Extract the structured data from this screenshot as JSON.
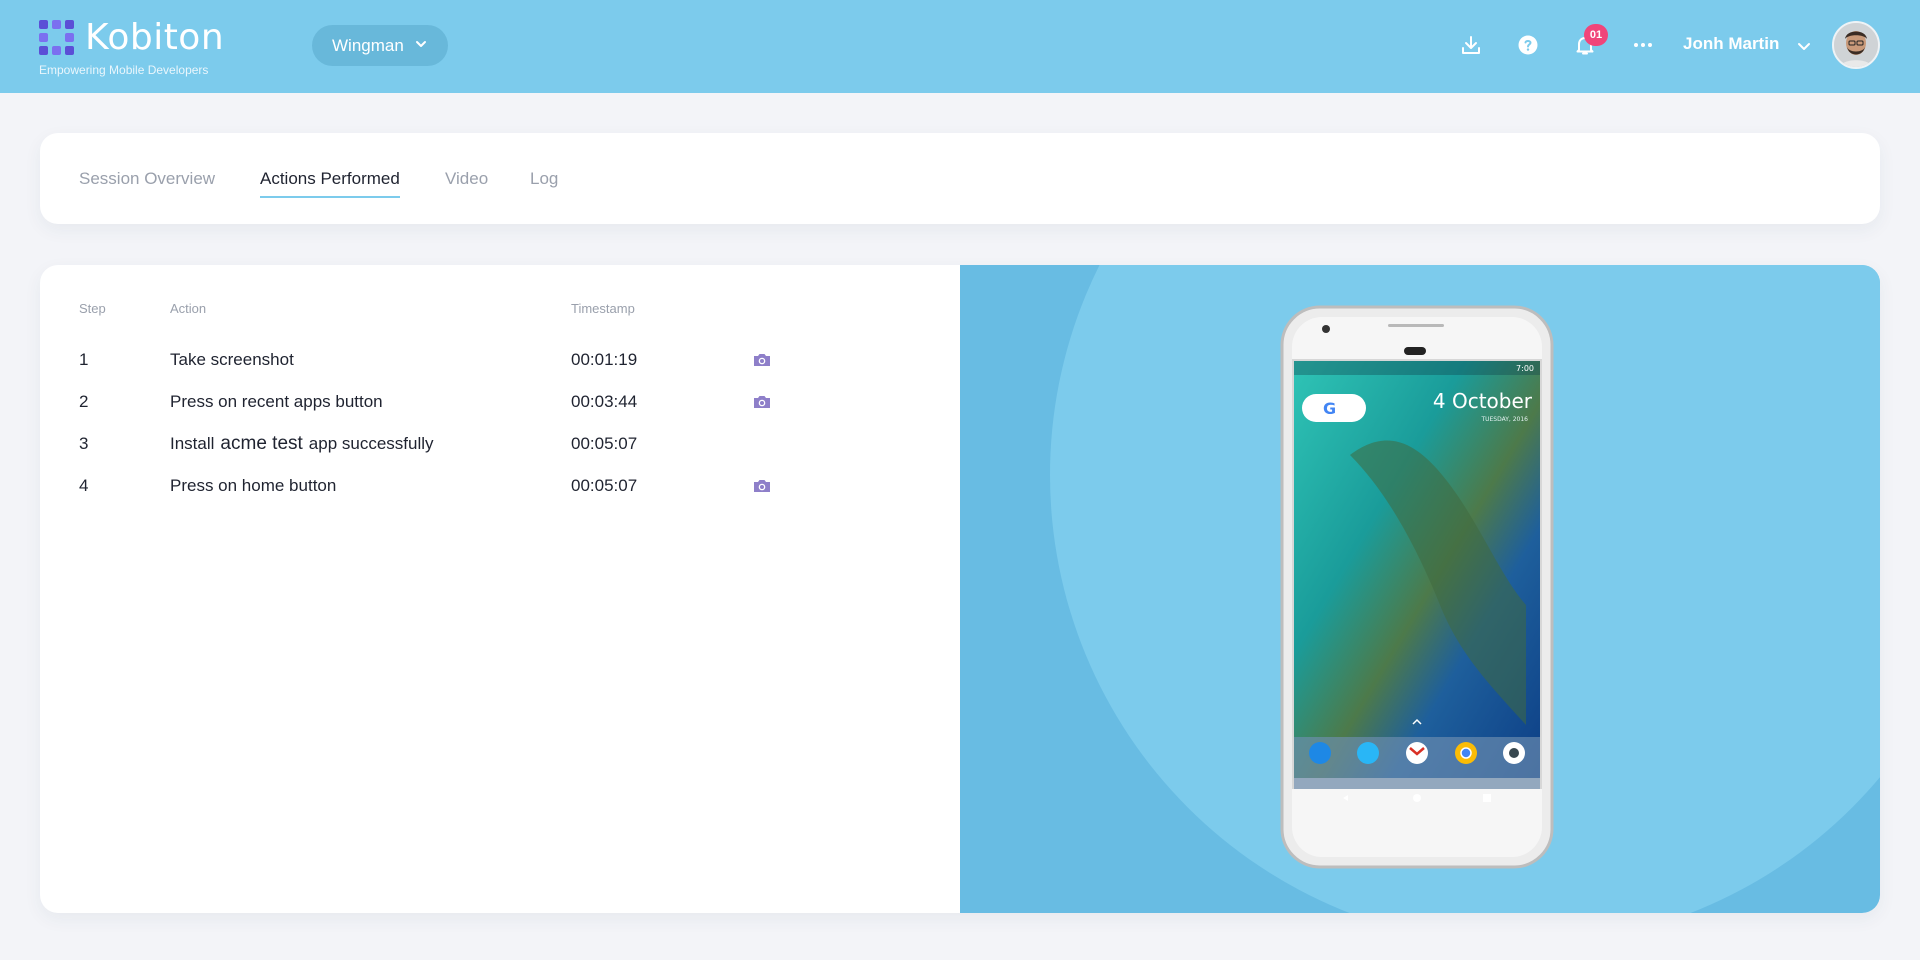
{
  "header": {
    "logo_name": "Kobiton",
    "logo_tagline": "Empowering Mobile Developers",
    "project_label": "Wingman",
    "notification_count": "01",
    "user_name": "Jonh Martin",
    "icons": [
      "download-icon",
      "help-icon",
      "bell-icon",
      "more-icon",
      "chevron-down-icon"
    ]
  },
  "tabs": [
    {
      "label": "Session Overview",
      "active": false
    },
    {
      "label": "Actions Performed",
      "active": true
    },
    {
      "label": "Video",
      "active": false
    },
    {
      "label": "Log",
      "active": false
    }
  ],
  "table": {
    "columns": {
      "step": "Step",
      "action": "Action",
      "timestamp": "Timestamp"
    },
    "rows": [
      {
        "step": "1",
        "action": "Take screenshot",
        "timestamp": "00:01:19",
        "has_screenshot": true
      },
      {
        "step": "2",
        "action": "Press on recent apps button",
        "timestamp": "00:03:44",
        "has_screenshot": true
      },
      {
        "step": "3",
        "action_prefix": "Install",
        "action_highlight": "acme test",
        "action_suffix": "app successfully",
        "timestamp": "00:05:07",
        "has_screenshot": false
      },
      {
        "step": "4",
        "action": "Press on home button",
        "timestamp": "00:05:07",
        "has_screenshot": true
      }
    ]
  },
  "device": {
    "date": "4 October",
    "weekday": "TUESDAY, 2016",
    "clock": "7:00"
  },
  "colors": {
    "header_bg": "#7ccbec",
    "accent_purple": "#8e7fc9",
    "badge": "#f0457a",
    "preview_bg": "#68bce3"
  }
}
